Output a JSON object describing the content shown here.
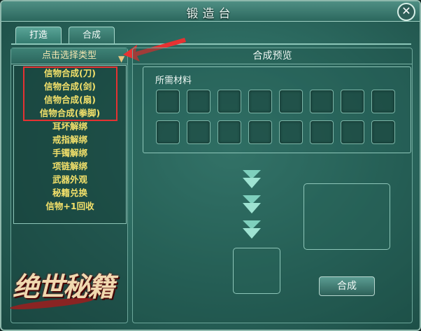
{
  "window": {
    "title": "锻造台",
    "close_symbol": "✕"
  },
  "tabs": [
    {
      "label": "打造",
      "active": true
    },
    {
      "label": "合成",
      "active": false
    }
  ],
  "left_panel": {
    "type_header": "点击选择类型",
    "items": [
      "信物合成(刀)",
      "信物合成(剑)",
      "信物合成(扇)",
      "信物合成(拳脚)",
      "耳坏解绑",
      "戒指解绑",
      "手镯解绑",
      "项链解绑",
      "武器外观",
      "秘籍兑换",
      "信物+1回收"
    ],
    "logo_text": "绝世秘籍"
  },
  "right_panel": {
    "header": "合成预览",
    "materials_label": "所需材料",
    "slot_count": 16,
    "synth_button": "合成"
  },
  "colors": {
    "item_text": "#f2e06a",
    "highlight": "#e53232",
    "panel_bg": "#2c6a60"
  }
}
